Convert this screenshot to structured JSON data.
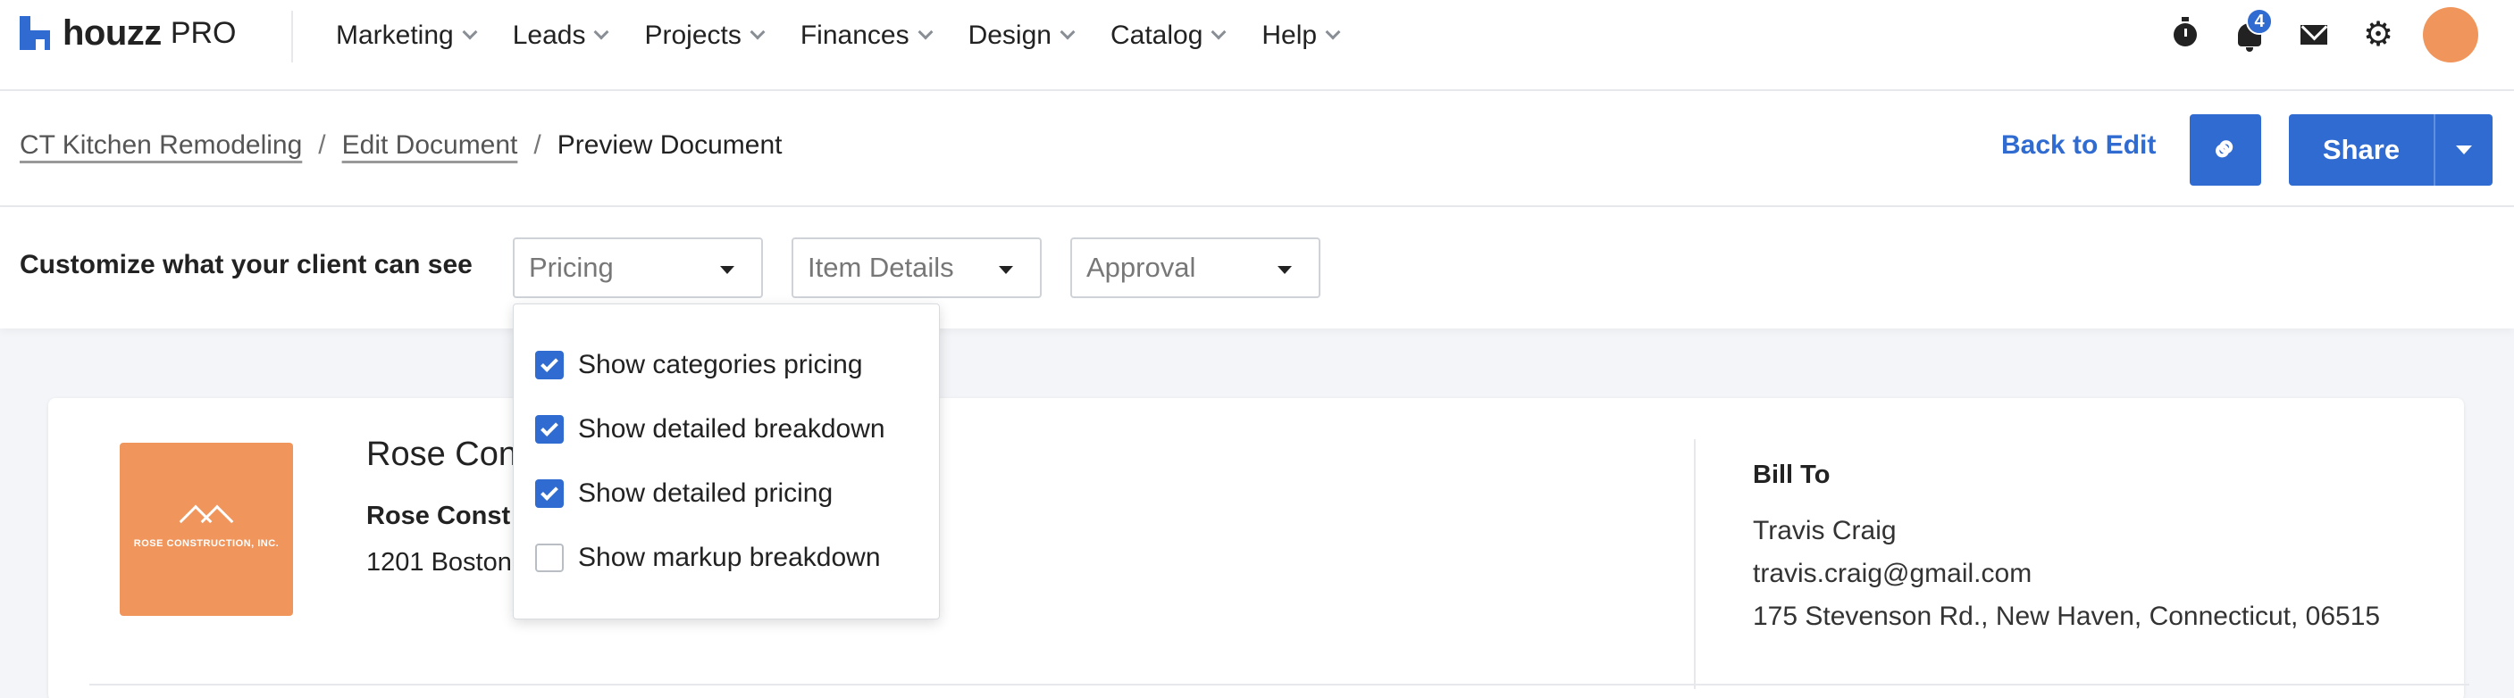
{
  "brand": {
    "name": "houzz",
    "product": "PRO"
  },
  "nav": {
    "items": [
      "Marketing",
      "Leads",
      "Projects",
      "Finances",
      "Design",
      "Catalog",
      "Help"
    ],
    "notification_count": "4"
  },
  "breadcrumb": {
    "project": "CT Kitchen Remodeling",
    "edit": "Edit Document",
    "separator": "/",
    "current": "Preview Document"
  },
  "actions": {
    "back_to_edit": "Back to Edit",
    "share": "Share"
  },
  "customize": {
    "label": "Customize what your client can see",
    "selects": {
      "pricing": "Pricing",
      "item_details": "Item Details",
      "approval": "Approval"
    }
  },
  "pricing_menu": {
    "options": [
      {
        "label": "Show categories pricing",
        "checked": true
      },
      {
        "label": "Show detailed breakdown",
        "checked": true
      },
      {
        "label": "Show detailed pricing",
        "checked": true
      },
      {
        "label": "Show markup breakdown",
        "checked": false
      }
    ]
  },
  "company": {
    "name_partial": "Rose Con",
    "sub_partial": "Rose Const",
    "address_partial": "1201 Boston",
    "logo_text": "ROSE CONSTRUCTION, INC."
  },
  "bill_to": {
    "title": "Bill To",
    "name": "Travis Craig",
    "email": "travis.craig@gmail.com",
    "address": "175 Stevenson Rd., New Haven, Connecticut, 06515"
  },
  "colors": {
    "accent": "#2f6bd0",
    "logo_bg": "#f0965c"
  }
}
